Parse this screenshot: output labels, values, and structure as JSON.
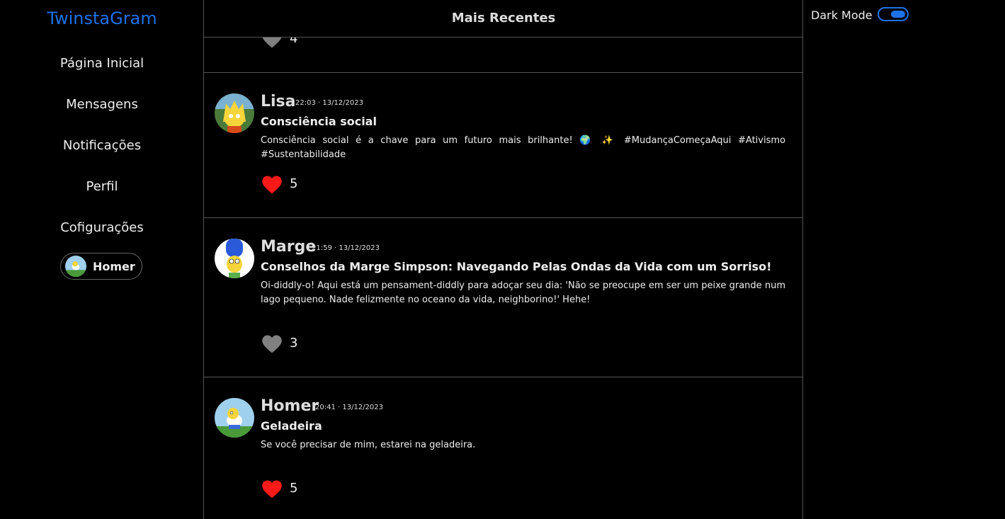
{
  "app": {
    "logo": "TwinstaGram"
  },
  "sidebar": {
    "items": [
      {
        "label": "Página Inicial"
      },
      {
        "label": "Mensagens"
      },
      {
        "label": "Notificações"
      },
      {
        "label": "Perfil"
      },
      {
        "label": "Cofigurações"
      }
    ],
    "user": {
      "name": "Homer"
    }
  },
  "feed": {
    "header": "Mais Recentes",
    "partial_post": {
      "likes": "4",
      "liked": false
    },
    "posts": [
      {
        "author": "Lisa",
        "timestamp": "22:03 · 13/12/2023",
        "title": "Consciência social",
        "body": "Consciência social é a chave para um futuro mais brilhante! 🌍 ✨ #MudançaComeçaAqui #Ativismo #Sustentabilidade",
        "likes": "5",
        "liked": true
      },
      {
        "author": "Marge",
        "timestamp": "21:59 · 13/12/2023",
        "title": "Conselhos da Marge Simpson: Navegando Pelas Ondas da Vida com um Sorriso!",
        "body": "Oi-diddly-o! Aqui está um pensament-diddly para adoçar seu dia: 'Não se preocupe em ser um peixe grande num lago pequeno. Nade felizmente no oceano da vida, neighborino!' Hehe!",
        "likes": "3",
        "liked": false
      },
      {
        "author": "Homer",
        "timestamp": "20:41 · 13/12/2023",
        "title": "Geladeira",
        "body": "Se você precisar de mim, estarei na geladeira.",
        "likes": "5",
        "liked": true
      }
    ]
  },
  "settings": {
    "dark_mode_label": "Dark Mode",
    "dark_mode_on": true
  },
  "colors": {
    "accent": "#1d72e8",
    "like_active": "#ff1a1a",
    "like_inactive": "#808080",
    "divider": "#555555"
  }
}
